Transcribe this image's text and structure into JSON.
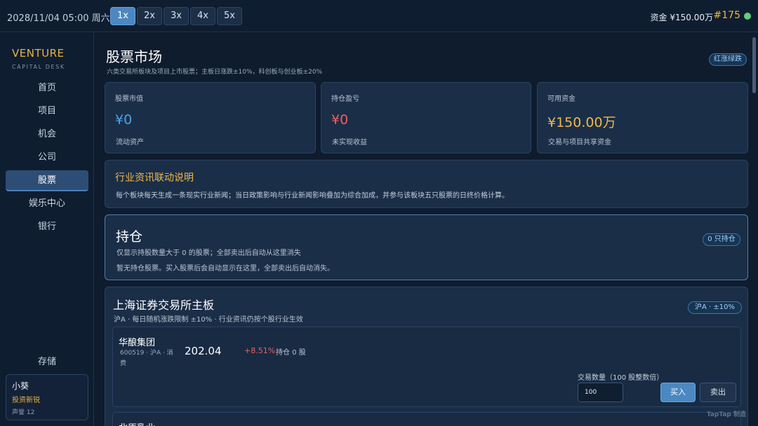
{
  "topbar": {
    "datetime": "2028/11/04 05:00 周六",
    "speeds": [
      "1x",
      "2x",
      "3x",
      "4x",
      "5x"
    ],
    "funds": "资金 ¥150.00万",
    "rank": "#175"
  },
  "sidebar": {
    "brand": "VENTURE",
    "brand_sub": "CAPITAL DESK",
    "items": [
      "首页",
      "项目",
      "机会",
      "公司",
      "股票",
      "娱乐中心",
      "银行"
    ],
    "active_index": 4,
    "save": "存储",
    "user": {
      "name": "小葵",
      "title": "投资新锐",
      "reputation": "声誉 12"
    }
  },
  "page": {
    "title": "股票市场",
    "subtitle": "六类交易所板块及项目上市股票；主板日涨跌±10%，科创板与创业板±20%",
    "color_mode": "红涨绿跌"
  },
  "stats": [
    {
      "label": "股票市值",
      "value": "¥0",
      "note": "流动资产",
      "color": "#4da3e6"
    },
    {
      "label": "持仓盈亏",
      "value": "¥0",
      "note": "未实现收益",
      "color": "#ef5d62"
    },
    {
      "label": "可用资金",
      "value": "¥150.00万",
      "note": "交易与项目共享资金",
      "color": "#f1b84a"
    }
  ],
  "info": {
    "title": "行业资讯联动说明",
    "text": "每个板块每天生成一条现实行业新闻；当日政策影响与行业新闻影响叠加为综合加成，并参与该板块五只股票的日终价格计算。"
  },
  "holdings": {
    "title": "持仓",
    "count_badge": "0 只持仓",
    "subtitle": "仅显示持股数量大于 0 的股票；全部卖出后自动从这里消失",
    "empty_text": "暂无持仓股票。买入股票后会自动显示在这里，全部卖出后自动消失。"
  },
  "exchange": {
    "title": "上海证券交易所主板",
    "subtitle": "沪A · 每日随机涨跌限制 ±10% · 行业资讯仍按个股行业生效",
    "badge": "沪A · ±10%",
    "stocks": [
      {
        "name": "华酿集团",
        "meta": "600519 · 沪A · 消费",
        "price": "202.04",
        "change": "+8.51%",
        "position": "持仓 0 股",
        "qty_label": "交易数量（100 股整数倍）",
        "qty_value": "100",
        "buy_label": "买入",
        "sell_label": "卖出"
      },
      {
        "name": "北原乳业"
      }
    ]
  },
  "watermark": "TapTap 制造"
}
